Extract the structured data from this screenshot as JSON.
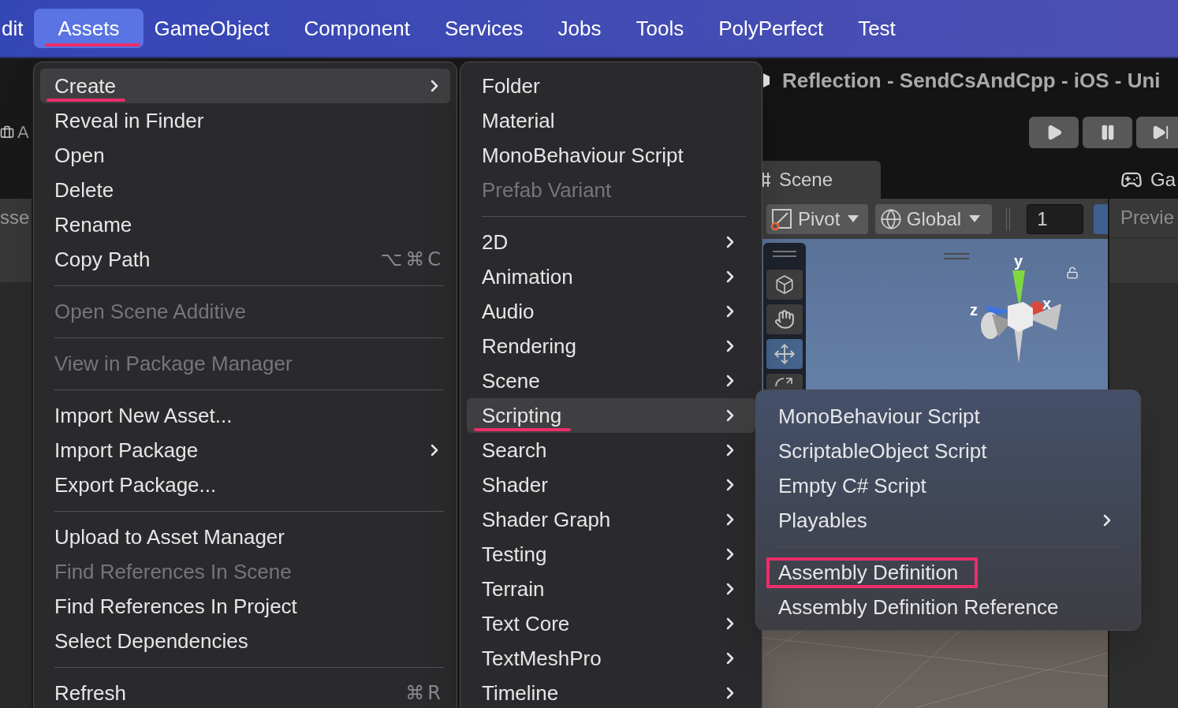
{
  "menu_bar": {
    "items": [
      {
        "label": "dit",
        "selected": false,
        "underlined": false
      },
      {
        "label": "Assets",
        "selected": true,
        "underlined": true
      },
      {
        "label": "GameObject",
        "selected": false,
        "underlined": false
      },
      {
        "label": "Component",
        "selected": false,
        "underlined": false
      },
      {
        "label": "Services",
        "selected": false,
        "underlined": false
      },
      {
        "label": "Jobs",
        "selected": false,
        "underlined": false
      },
      {
        "label": "Tools",
        "selected": false,
        "underlined": false
      },
      {
        "label": "PolyPerfect",
        "selected": false,
        "underlined": false
      },
      {
        "label": "Test",
        "selected": false,
        "underlined": false
      }
    ]
  },
  "editor": {
    "project_panel": {
      "label": "A",
      "tab": "sse"
    },
    "window_title": "Reflection - SendCsAndCpp - iOS - Uni",
    "tabs": [
      {
        "label": "Scene",
        "selected": true
      },
      {
        "label": "Ga",
        "selected": false
      }
    ],
    "toolbar": {
      "pivot": "Pivot",
      "space": "Global",
      "snap_value": "1"
    },
    "tool_strip": [
      {
        "kind": "view",
        "selected": false
      },
      {
        "kind": "hand",
        "selected": false
      },
      {
        "kind": "move",
        "selected": true
      },
      {
        "kind": "rotate",
        "selected": false
      }
    ],
    "gizmo_labels": [
      "y",
      "x",
      "z"
    ],
    "side_panel": {
      "label": "Previe"
    }
  },
  "menus": [
    {
      "items": [
        {
          "kind": "item",
          "label": "Create",
          "selected": true,
          "disabled": false,
          "submenu": true,
          "underlined": true
        },
        {
          "kind": "item",
          "label": "Reveal in Finder",
          "selected": false,
          "disabled": false,
          "submenu": false,
          "underlined": false
        },
        {
          "kind": "item",
          "label": "Open",
          "selected": false,
          "disabled": false,
          "submenu": false,
          "underlined": false
        },
        {
          "kind": "item",
          "label": "Delete",
          "selected": false,
          "disabled": false,
          "submenu": false,
          "underlined": false
        },
        {
          "kind": "item",
          "label": "Rename",
          "selected": false,
          "disabled": false,
          "submenu": false,
          "underlined": false
        },
        {
          "kind": "item",
          "label": "Copy Path",
          "shortcut": "⌥⌘C",
          "selected": false,
          "disabled": false,
          "submenu": false,
          "underlined": false
        },
        {
          "kind": "separator"
        },
        {
          "kind": "item",
          "label": "Open Scene Additive",
          "selected": false,
          "disabled": true,
          "submenu": false,
          "underlined": false
        },
        {
          "kind": "separator"
        },
        {
          "kind": "item",
          "label": "View in Package Manager",
          "selected": false,
          "disabled": true,
          "submenu": false,
          "underlined": false
        },
        {
          "kind": "separator"
        },
        {
          "kind": "item",
          "label": "Import New Asset...",
          "selected": false,
          "disabled": false,
          "submenu": false,
          "underlined": false
        },
        {
          "kind": "item",
          "label": "Import Package",
          "selected": false,
          "disabled": false,
          "submenu": true,
          "underlined": false
        },
        {
          "kind": "item",
          "label": "Export Package...",
          "selected": false,
          "disabled": false,
          "submenu": false,
          "underlined": false
        },
        {
          "kind": "separator"
        },
        {
          "kind": "item",
          "label": "Upload to Asset Manager",
          "selected": false,
          "disabled": false,
          "submenu": false,
          "underlined": false
        },
        {
          "kind": "item",
          "label": "Find References In Scene",
          "selected": false,
          "disabled": true,
          "submenu": false,
          "underlined": false
        },
        {
          "kind": "item",
          "label": "Find References In Project",
          "selected": false,
          "disabled": false,
          "submenu": false,
          "underlined": false
        },
        {
          "kind": "item",
          "label": "Select Dependencies",
          "selected": false,
          "disabled": false,
          "submenu": false,
          "underlined": false
        },
        {
          "kind": "separator"
        },
        {
          "kind": "item",
          "label": "Refresh",
          "shortcut": "⌘R",
          "selected": false,
          "disabled": false,
          "submenu": false,
          "underlined": false
        }
      ]
    },
    {
      "items": [
        {
          "kind": "item",
          "label": "Folder",
          "selected": false,
          "disabled": false,
          "submenu": false,
          "underlined": false
        },
        {
          "kind": "item",
          "label": "Material",
          "selected": false,
          "disabled": false,
          "submenu": false,
          "underlined": false
        },
        {
          "kind": "item",
          "label": "MonoBehaviour Script",
          "selected": false,
          "disabled": false,
          "submenu": false,
          "underlined": false
        },
        {
          "kind": "item",
          "label": "Prefab Variant",
          "selected": false,
          "disabled": true,
          "submenu": false,
          "underlined": false
        },
        {
          "kind": "separator"
        },
        {
          "kind": "item",
          "label": "2D",
          "selected": false,
          "disabled": false,
          "submenu": true,
          "underlined": false
        },
        {
          "kind": "item",
          "label": "Animation",
          "selected": false,
          "disabled": false,
          "submenu": true,
          "underlined": false
        },
        {
          "kind": "item",
          "label": "Audio",
          "selected": false,
          "disabled": false,
          "submenu": true,
          "underlined": false
        },
        {
          "kind": "item",
          "label": "Rendering",
          "selected": false,
          "disabled": false,
          "submenu": true,
          "underlined": false
        },
        {
          "kind": "item",
          "label": "Scene",
          "selected": false,
          "disabled": false,
          "submenu": true,
          "underlined": false
        },
        {
          "kind": "item",
          "label": "Scripting",
          "selected": true,
          "disabled": false,
          "submenu": true,
          "underlined": true
        },
        {
          "kind": "item",
          "label": "Search",
          "selected": false,
          "disabled": false,
          "submenu": true,
          "underlined": false
        },
        {
          "kind": "item",
          "label": "Shader",
          "selected": false,
          "disabled": false,
          "submenu": true,
          "underlined": false
        },
        {
          "kind": "item",
          "label": "Shader Graph",
          "selected": false,
          "disabled": false,
          "submenu": true,
          "underlined": false
        },
        {
          "kind": "item",
          "label": "Testing",
          "selected": false,
          "disabled": false,
          "submenu": true,
          "underlined": false
        },
        {
          "kind": "item",
          "label": "Terrain",
          "selected": false,
          "disabled": false,
          "submenu": true,
          "underlined": false
        },
        {
          "kind": "item",
          "label": "Text Core",
          "selected": false,
          "disabled": false,
          "submenu": true,
          "underlined": false
        },
        {
          "kind": "item",
          "label": "TextMeshPro",
          "selected": false,
          "disabled": false,
          "submenu": true,
          "underlined": false
        },
        {
          "kind": "item",
          "label": "Timeline",
          "selected": false,
          "disabled": false,
          "submenu": true,
          "underlined": false
        }
      ]
    },
    {
      "items": [
        {
          "kind": "item",
          "label": "MonoBehaviour Script",
          "selected": false,
          "disabled": false,
          "submenu": false,
          "outlined": false
        },
        {
          "kind": "item",
          "label": "ScriptableObject Script",
          "selected": false,
          "disabled": false,
          "submenu": false,
          "outlined": false
        },
        {
          "kind": "item",
          "label": "Empty C# Script",
          "selected": false,
          "disabled": false,
          "submenu": false,
          "outlined": false
        },
        {
          "kind": "item",
          "label": "Playables",
          "selected": false,
          "disabled": false,
          "submenu": true,
          "outlined": false
        },
        {
          "kind": "separator"
        },
        {
          "kind": "item",
          "label": "Assembly Definition",
          "selected": false,
          "disabled": false,
          "submenu": false,
          "outlined": true
        },
        {
          "kind": "item",
          "label": "Assembly Definition Reference",
          "selected": false,
          "disabled": false,
          "submenu": false,
          "outlined": false
        }
      ]
    }
  ]
}
